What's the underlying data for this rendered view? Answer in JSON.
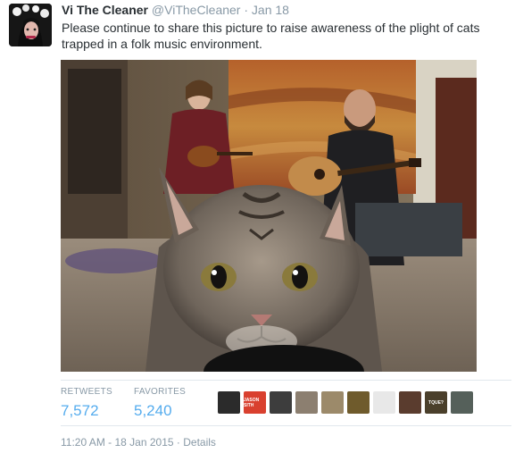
{
  "tweet": {
    "display_name": "Vi The Cleaner",
    "handle": "@ViTheCleaner",
    "separator": "·",
    "date": "Jan 18",
    "text": "Please continue to share this picture to raise awareness of the plight of cats trapped in a folk music environment."
  },
  "stats": {
    "retweets_label": "RETWEETS",
    "retweets_value": "7,572",
    "favorites_label": "FAVORITES",
    "favorites_value": "5,240"
  },
  "favoriters": [
    {
      "name": "faver-avatar-1",
      "color": "#2b2b2b"
    },
    {
      "name": "faver-avatar-2",
      "color": "#d9402f",
      "text": "JASON SITH"
    },
    {
      "name": "faver-avatar-3",
      "color": "#3d3d3d"
    },
    {
      "name": "faver-avatar-4",
      "color": "#8c7f70"
    },
    {
      "name": "faver-avatar-5",
      "color": "#9c8a6a"
    },
    {
      "name": "faver-avatar-6",
      "color": "#6f5b2c"
    },
    {
      "name": "faver-avatar-7",
      "color": "#e8e8e8"
    },
    {
      "name": "faver-avatar-8",
      "color": "#5a3c2e"
    },
    {
      "name": "faver-avatar-9",
      "color": "#4a3f2b",
      "text": "TQUE?"
    },
    {
      "name": "faver-avatar-10",
      "color": "#55605a"
    }
  ],
  "footer": {
    "time": "11:20 AM",
    "separator": "-",
    "date": "18 Jan 2015",
    "separator2": "·",
    "details": "Details"
  },
  "colors": {
    "link": "#55acee",
    "muted": "#8899a6",
    "text": "#292f33",
    "divider": "#e1e8ed"
  }
}
